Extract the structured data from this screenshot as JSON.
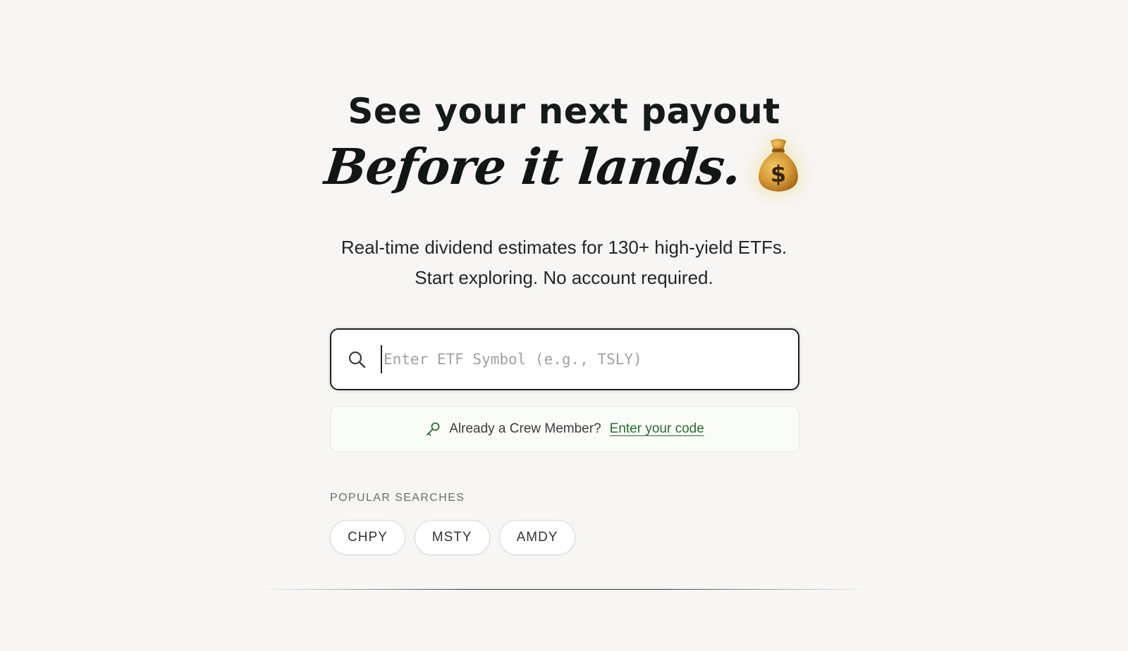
{
  "hero": {
    "headline": "See your next payout",
    "script_line": "Before it lands.",
    "emoji_icon": "money-bag-icon"
  },
  "subtitle": {
    "line1": "Real-time dividend estimates for 130+ high-yield ETFs.",
    "line2": "Start exploring. No account required."
  },
  "search": {
    "placeholder": "Enter ETF Symbol (e.g., TSLY)",
    "value": "",
    "icon": "search-icon"
  },
  "crew": {
    "icon": "key-icon",
    "prompt": "Already a Crew Member?",
    "link_label": "Enter your code",
    "link_color": "#2d6a36"
  },
  "popular": {
    "label": "POPULAR SEARCHES",
    "items": [
      "CHPY",
      "MSTY",
      "AMDY"
    ]
  },
  "colors": {
    "background": "#f7f6f4",
    "text_dark": "#141a17",
    "accent_green": "#2d6a36"
  }
}
